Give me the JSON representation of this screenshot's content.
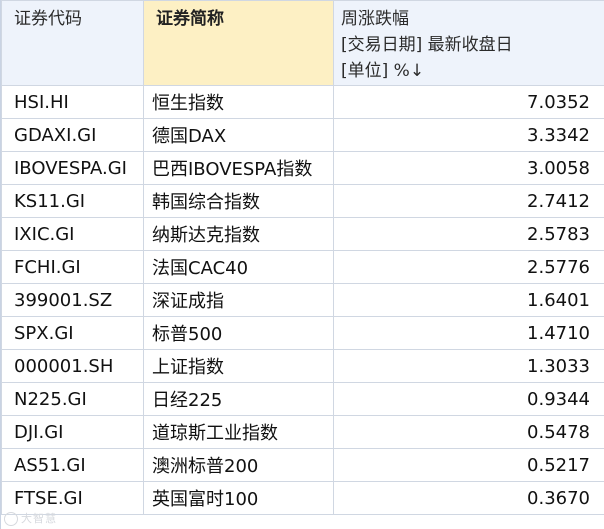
{
  "columns": {
    "code": "证券代码",
    "name": "证券简称",
    "change_line1": "周涨跌幅",
    "change_line2": "[交易日期] 最新收盘日",
    "change_line3": "[单位] %↓"
  },
  "rows": [
    {
      "code": "HSI.HI",
      "name": "恒生指数",
      "value": "7.0352"
    },
    {
      "code": "GDAXI.GI",
      "name": "德国DAX",
      "value": "3.3342"
    },
    {
      "code": "IBOVESPA.GI",
      "name": "巴西IBOVESPA指数",
      "value": "3.0058"
    },
    {
      "code": "KS11.GI",
      "name": "韩国综合指数",
      "value": "2.7412"
    },
    {
      "code": "IXIC.GI",
      "name": "纳斯达克指数",
      "value": "2.5783"
    },
    {
      "code": "FCHI.GI",
      "name": "法国CAC40",
      "value": "2.5776"
    },
    {
      "code": "399001.SZ",
      "name": "深证成指",
      "value": "1.6401"
    },
    {
      "code": "SPX.GI",
      "name": "标普500",
      "value": "1.4710"
    },
    {
      "code": "000001.SH",
      "name": "上证指数",
      "value": "1.3033"
    },
    {
      "code": "N225.GI",
      "name": "日经225",
      "value": "0.9344"
    },
    {
      "code": "DJI.GI",
      "name": "道琼斯工业指数",
      "value": "0.5478"
    },
    {
      "code": "AS51.GI",
      "name": "澳洲标普200",
      "value": "0.5217"
    },
    {
      "code": "FTSE.GI",
      "name": "英国富时100",
      "value": "0.3670"
    }
  ],
  "watermark": "大智慧",
  "colors": {
    "header_bg": "#eef3fb",
    "sorted_header_bg": "#fdf0c4",
    "grid_line": "#d0d7e2"
  }
}
